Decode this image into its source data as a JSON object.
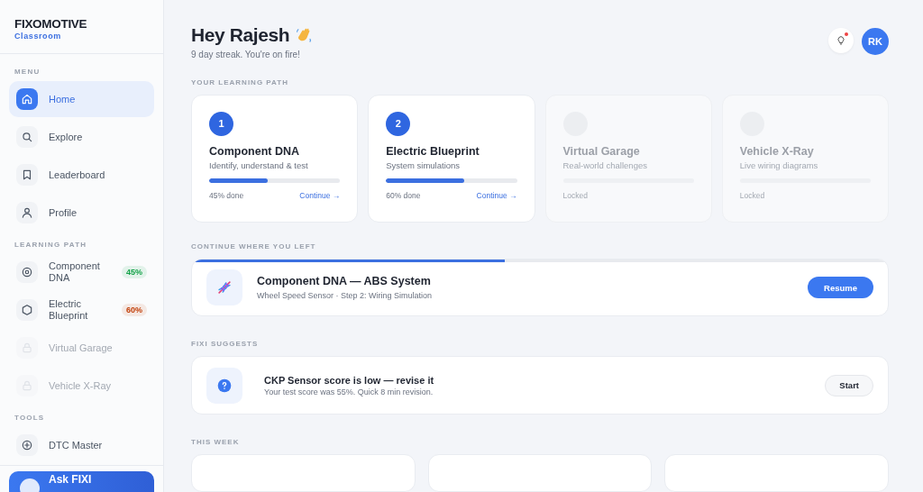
{
  "brand": {
    "name": "FIXOMOTIVE",
    "subtitle": "Classroom"
  },
  "sidebar": {
    "sections": [
      {
        "label": "MENU",
        "items": [
          {
            "label": "Home",
            "selected": true,
            "locked": false
          },
          {
            "label": "Explore",
            "selected": false,
            "locked": false
          },
          {
            "label": "Leaderboard",
            "selected": false,
            "locked": false
          },
          {
            "label": "Profile",
            "selected": false,
            "locked": false
          }
        ]
      },
      {
        "label": "LEARNING PATH",
        "items": [
          {
            "label": "Component DNA",
            "selected": false,
            "locked": false,
            "badge": "45%",
            "color": "#16a34a"
          },
          {
            "label": "Electric Blueprint",
            "selected": false,
            "locked": false,
            "badge": "60%",
            "color": "#c2410c"
          },
          {
            "label": "Virtual Garage",
            "selected": false,
            "locked": true
          },
          {
            "label": "Vehicle X-Ray",
            "selected": false,
            "locked": true
          }
        ]
      },
      {
        "label": "TOOLS",
        "items": [
          {
            "label": "DTC Master",
            "selected": false,
            "locked": false
          }
        ]
      }
    ],
    "ask_button": "Ask FIXI"
  },
  "header": {
    "greeting": "Hey Rajesh",
    "streak": "9 day streak. You're on fire!",
    "notification": true,
    "avatar": "RK"
  },
  "learning_path": {
    "label": "YOUR LEARNING PATH",
    "cards": [
      {
        "step": "1",
        "title": "Component DNA",
        "subtitle": "Identify, understand & test",
        "level": 0.45,
        "status": "45% done",
        "action": "Continue →",
        "locked": false
      },
      {
        "step": "2",
        "title": "Electric Blueprint",
        "subtitle": "System simulations",
        "level": 0.6,
        "status": "60% done",
        "action": "Continue →",
        "locked": false
      },
      {
        "title": "Virtual Garage",
        "subtitle": "Real-world challenges",
        "status": "Locked",
        "locked": true
      },
      {
        "title": "Vehicle X-Ray",
        "subtitle": "Live wiring diagrams",
        "status": "Locked",
        "locked": true
      }
    ]
  },
  "continue": {
    "label": "CONTINUE WHERE YOU LEFT",
    "level": 0.45,
    "title": "Component DNA — ABS System",
    "subtitle": "Wheel Speed Sensor · Step 2: Wiring Simulation",
    "button": "Resume"
  },
  "suggest": {
    "label": "FIXI SUGGESTS",
    "title": "CKP Sensor score is low — revise it",
    "subtitle": "Your test score was 55%. Quick 8 min revision.",
    "button": "Start"
  },
  "this_week": {
    "label": "THIS WEEK"
  }
}
